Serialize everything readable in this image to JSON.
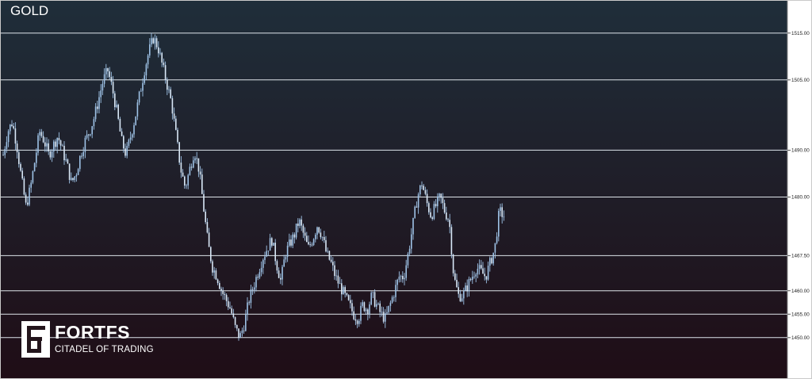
{
  "chart_data": {
    "type": "candlestick",
    "symbol": "GOLD",
    "y_range": [
      1446,
      1522
    ],
    "price_levels": [
      1515.0,
      1505.0,
      1490.0,
      1480.0,
      1467.5,
      1460.0,
      1455.0,
      1450.0
    ],
    "price_labels": [
      "1515.00",
      "1505.00",
      "1490.00",
      "1480.00",
      "1467.50",
      "1460.00",
      "1455.00",
      "1450.00"
    ],
    "grid": "horizontal level lines only",
    "series": [
      {
        "values": [
          1489,
          1494,
          1496,
          1491,
          1484,
          1478,
          1482,
          1488,
          1494,
          1492,
          1489,
          1491,
          1493,
          1490,
          1487,
          1483,
          1485,
          1489,
          1492,
          1494,
          1497,
          1501,
          1505,
          1507,
          1503,
          1498,
          1492,
          1489,
          1493,
          1497,
          1502,
          1507,
          1511,
          1514,
          1512,
          1508,
          1504,
          1500,
          1493,
          1486,
          1482,
          1486,
          1490,
          1486,
          1478,
          1470,
          1465,
          1463,
          1460,
          1458,
          1456,
          1452,
          1450,
          1453,
          1458,
          1461,
          1464,
          1467,
          1469,
          1471,
          1466,
          1462,
          1468,
          1470,
          1472,
          1475,
          1472,
          1469,
          1471,
          1474,
          1472,
          1468,
          1466,
          1463,
          1461,
          1459,
          1457,
          1455,
          1454,
          1457,
          1456,
          1459,
          1457,
          1455,
          1454,
          1457,
          1460,
          1463,
          1463,
          1468,
          1474,
          1480,
          1483,
          1479,
          1476,
          1478,
          1480,
          1477,
          1475,
          1463,
          1459,
          1459,
          1461,
          1463,
          1465,
          1464,
          1463,
          1466,
          1469,
          1477,
          1476
        ]
      }
    ]
  },
  "symbol_label": "GOLD",
  "branding": {
    "name": "FORTFS",
    "tagline": "CITADEL OF TRADING"
  },
  "colors": {
    "background_top": "#1f2e3a",
    "background_bottom": "#1f0d16",
    "candles": "#9ec2e6",
    "level_lines": "#dde4ea",
    "axis_background": "#ffffff",
    "axis_text": "#222222",
    "frame_border": "#c9c9c9"
  }
}
